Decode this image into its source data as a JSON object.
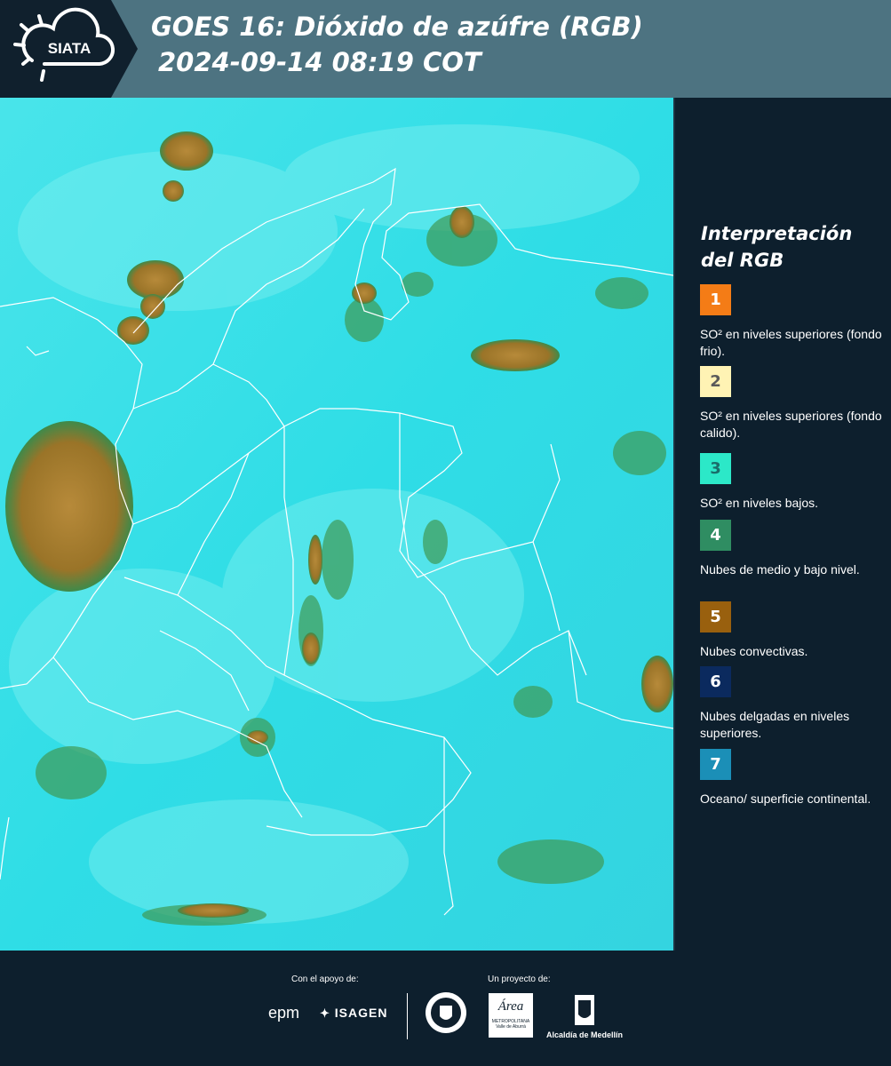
{
  "header": {
    "logo_text": "SIATA",
    "title_line1": "GOES 16: Dióxido de azúfre (RGB)",
    "title_line2": "2024-09-14 08:19 COT"
  },
  "legend": {
    "title_line1": "Interpretación",
    "title_line2": "del RGB",
    "items": [
      {
        "number": "1",
        "color": "#f47c16",
        "number_color": "#ffffff",
        "text": "SO² en niveles superiores (fondo frio)."
      },
      {
        "number": "2",
        "color": "#fff3b4",
        "number_color": "#5a5a5a",
        "text": "SO² en niveles superiores (fondo calido)."
      },
      {
        "number": "3",
        "color": "#2ce8c8",
        "number_color": "#1a6d6a",
        "text": "SO² en niveles bajos."
      },
      {
        "number": "4",
        "color": "#2f8d62",
        "number_color": "#ffffff",
        "text": "Nubes de medio y bajo nivel."
      },
      {
        "number": "5",
        "color": "#99600e",
        "number_color": "#ffffff",
        "text": "Nubes convectivas."
      },
      {
        "number": "6",
        "color": "#0b2a5e",
        "number_color": "#ffffff",
        "text": "Nubes delgadas en niveles superiores."
      },
      {
        "number": "7",
        "color": "#1b8fb7",
        "number_color": "#ffffff",
        "text": "Oceano/ superficie continental."
      }
    ]
  },
  "footer": {
    "support_label": "Con el apoyo de:",
    "project_label": "Un proyecto de:",
    "sponsor_1": "epm",
    "sponsor_2": "ISAGEN",
    "partner_1": "Área",
    "partner_1_sub": "METROPOLITANA",
    "partner_1_sub2": "Valle de Aburrá",
    "partner_2": "Alcaldía de Medellín"
  },
  "map_colors": {
    "background": "#2fdde6",
    "convective": "#9c7a2c",
    "low_cloud": "#3f9a55",
    "borders": "#ffffff"
  }
}
